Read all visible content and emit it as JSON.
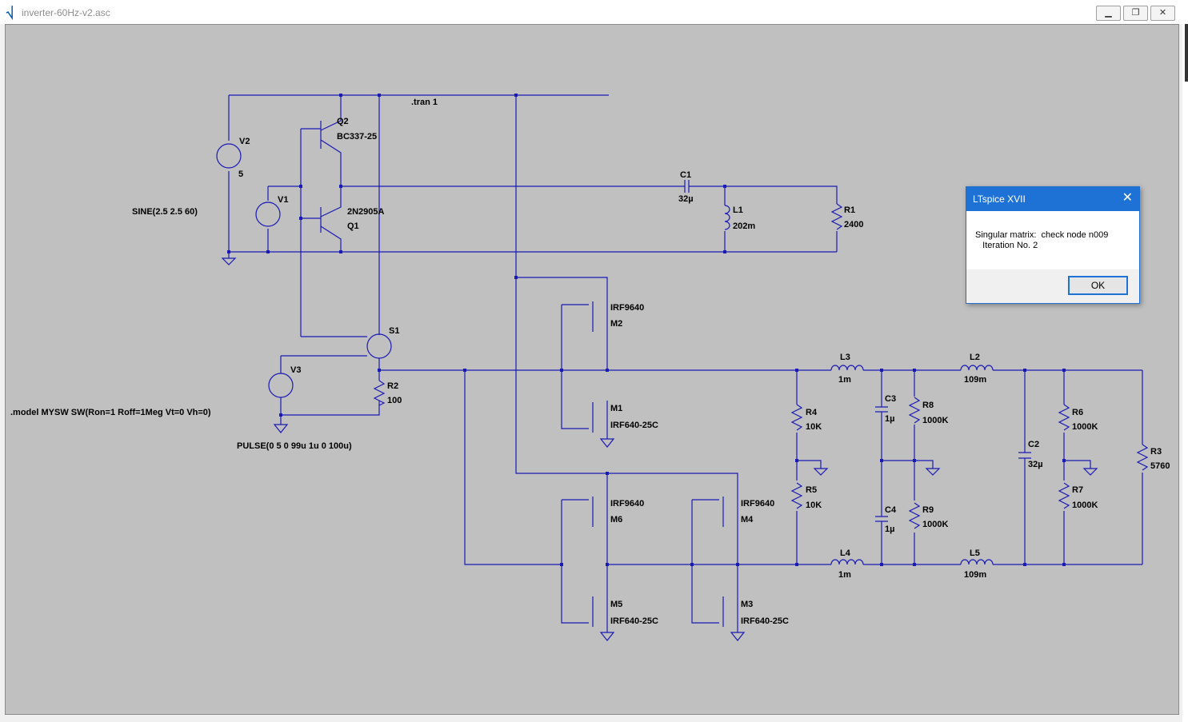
{
  "window": {
    "title": "inverter-60Hz-v2.asc",
    "app_icon": "ltspice-icon",
    "controls": {
      "minimize": "minimize-icon",
      "restore": "restore-icon",
      "close": "close-icon"
    }
  },
  "schematic": {
    "directives": {
      "tran": ".tran 1",
      "model": ".model MYSW SW(Ron=1 Roff=1Meg Vt=0 Vh=0)",
      "sine": "SINE(2.5 2.5 60)",
      "pulse": "PULSE(0 5 0 99u 1u 0 100u)"
    },
    "labels": {
      "V2": "V2",
      "V2_val": "5",
      "V1": "V1",
      "Q2": "Q2",
      "Q2_model": "BC337-25",
      "Q1": "Q1",
      "Q1_model": "2N2905A",
      "C1": "C1",
      "C1_val": "32µ",
      "L1": "L1",
      "L1_val": "202m",
      "R1": "R1",
      "R1_val": "2400",
      "S1": "S1",
      "V3": "V3",
      "R2": "R2",
      "R2_val": "100",
      "M2_model": "IRF9640",
      "M2": "M2",
      "M1": "M1",
      "M1_model": "IRF640-25C",
      "M6_model": "IRF9640",
      "M6": "M6",
      "M4_model": "IRF9640",
      "M4": "M4",
      "M5": "M5",
      "M5_model": "IRF640-25C",
      "M3": "M3",
      "M3_model": "IRF640-25C",
      "L3": "L3",
      "L3_val": "1m",
      "L2": "L2",
      "L2_val": "109m",
      "L4": "L4",
      "L4_val": "1m",
      "L5": "L5",
      "L5_val": "109m",
      "C3": "C3",
      "C3_val": "1µ",
      "C4": "C4",
      "C4_val": "1µ",
      "C2": "C2",
      "C2_val": "32µ",
      "R4": "R4",
      "R4_val": "10K",
      "R5": "R5",
      "R5_val": "10K",
      "R8": "R8",
      "R8_val": "1000K",
      "R9": "R9",
      "R9_val": "1000K",
      "R6": "R6",
      "R6_val": "1000K",
      "R7": "R7",
      "R7_val": "1000K",
      "R3": "R3",
      "R3_val": "5760"
    },
    "colors": {
      "wire": "#1a1ab4",
      "background": "#c0c0c0",
      "text": "#000000"
    }
  },
  "dialog": {
    "title": "LTspice XVII",
    "line1": "Singular matrix:  check node n009",
    "line2": "   Iteration No. 2",
    "ok_label": "OK",
    "close_icon": "close-icon"
  }
}
